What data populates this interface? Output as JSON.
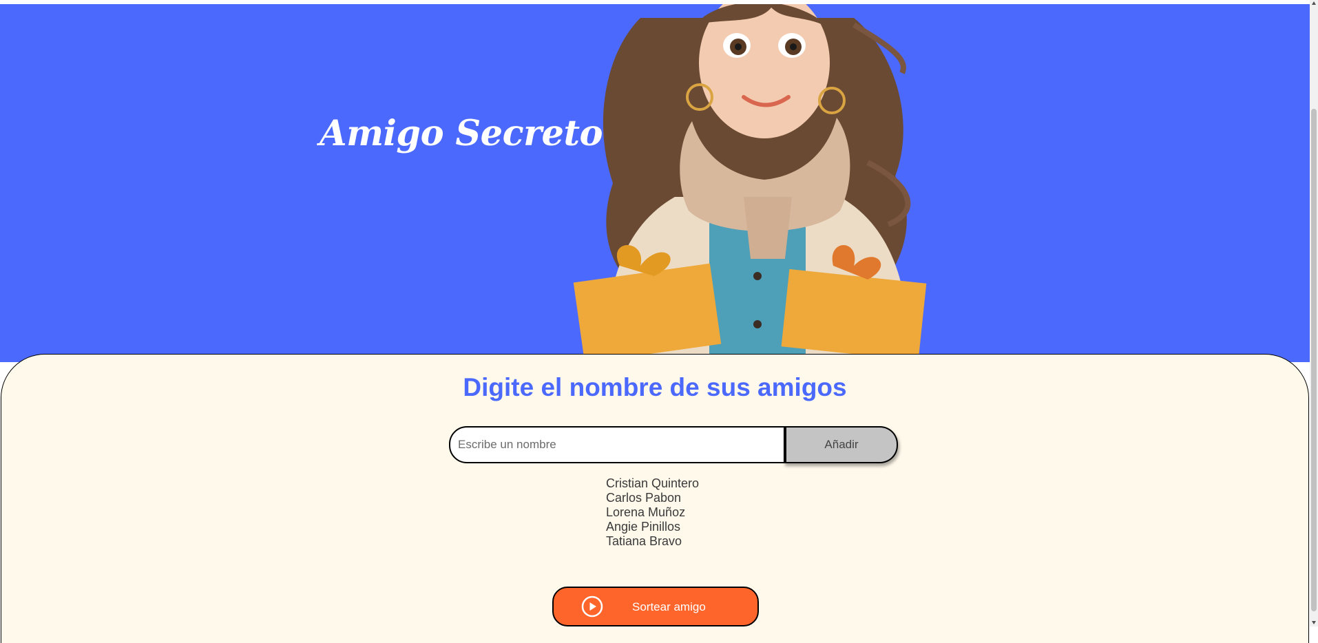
{
  "header": {
    "title": "Amigo Secreto",
    "illustration_icon": "girl-with-gifts-illustration"
  },
  "main": {
    "section_title": "Digite el nombre de sus amigos",
    "input": {
      "placeholder": "Escribe un nombre",
      "value": ""
    },
    "add_button_label": "Añadir",
    "friends": [
      "Cristian Quintero",
      "Carlos Pabon",
      "Lorena Muñoz",
      "Angie Pinillos",
      "Tatiana Bravo"
    ],
    "draw_button": {
      "label": "Sortear amigo",
      "icon": "play-circle-icon"
    }
  },
  "colors": {
    "hero_background": "#4b69fd",
    "content_background": "#fff9eb",
    "title_color": "#4b69fd",
    "add_button_background": "#c4c4c4",
    "draw_button_background": "#fe652b"
  }
}
